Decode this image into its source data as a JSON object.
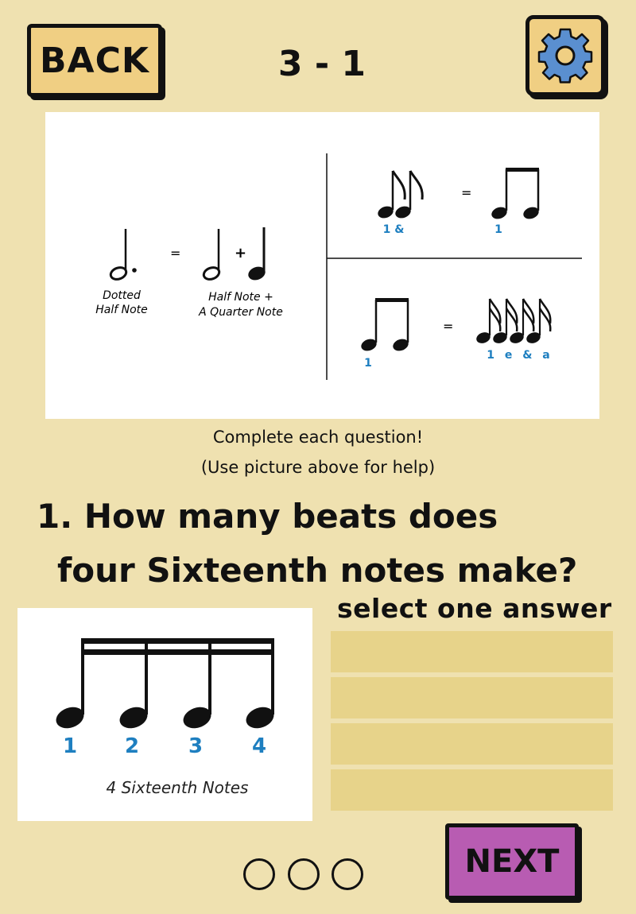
{
  "header": {
    "back_label": "BACK",
    "level": "3 - 1",
    "settings_icon": "gear-icon"
  },
  "reference_image": {
    "dotted_half_label_1": "Dotted",
    "dotted_half_label_2": "Half Note",
    "equals": "=",
    "plus": "+",
    "sum_label_1": "Half Note +",
    "sum_label_2": "A Quarter Note",
    "eighths_count": "1 &",
    "beamed_eighths_count": "1",
    "beamed_eighths_count_2": "1",
    "sixteenths_count": "1 e & a"
  },
  "instructions": {
    "line1": "Complete each question!",
    "line2": "(Use picture above for help)"
  },
  "question": {
    "number": "1.",
    "line1": "How many beats does",
    "line2": "four Sixteenth notes make?"
  },
  "select_label": "select one answer",
  "note_image": {
    "counts": [
      "1",
      "2",
      "3",
      "4"
    ],
    "caption": "4 Sixteenth Notes"
  },
  "answers": [
    "",
    "",
    "",
    ""
  ],
  "footer": {
    "next_label": "NEXT",
    "progress_dots": 3
  },
  "colors": {
    "background": "#EFE1B0",
    "button_yellow": "#F0CF83",
    "button_purple": "#B85CB2",
    "answer_slot": "#E7D38A",
    "count_blue": "#1E7FC0",
    "gear_blue": "#5A8FD0"
  }
}
